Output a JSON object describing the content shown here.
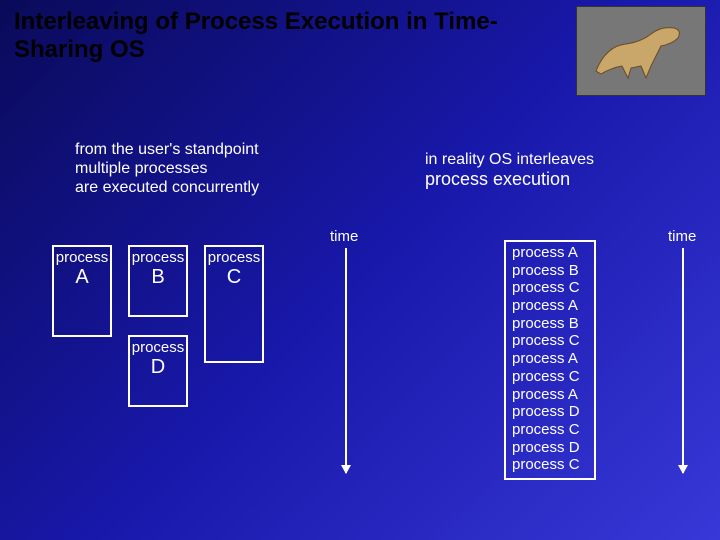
{
  "title": "Interleaving of Process Execution in Time-Sharing OS",
  "left_caption": {
    "l1": "from the user's standpoint",
    "l2": "multiple processes",
    "l3": "are executed concurrently"
  },
  "right_caption": {
    "l1": "in reality OS interleaves",
    "l2": "process execution"
  },
  "time_label": "time",
  "boxes": {
    "A": {
      "label": "process",
      "letter": "A"
    },
    "B": {
      "label": "process",
      "letter": "B"
    },
    "C": {
      "label": "process",
      "letter": "C"
    },
    "D": {
      "label": "process",
      "letter": "D"
    }
  },
  "schedule": [
    "process A",
    "process B",
    "process C",
    "process A",
    "process B",
    "process C",
    "process A",
    "process C",
    "process A",
    "process D",
    "process C",
    "process D",
    "process C"
  ]
}
